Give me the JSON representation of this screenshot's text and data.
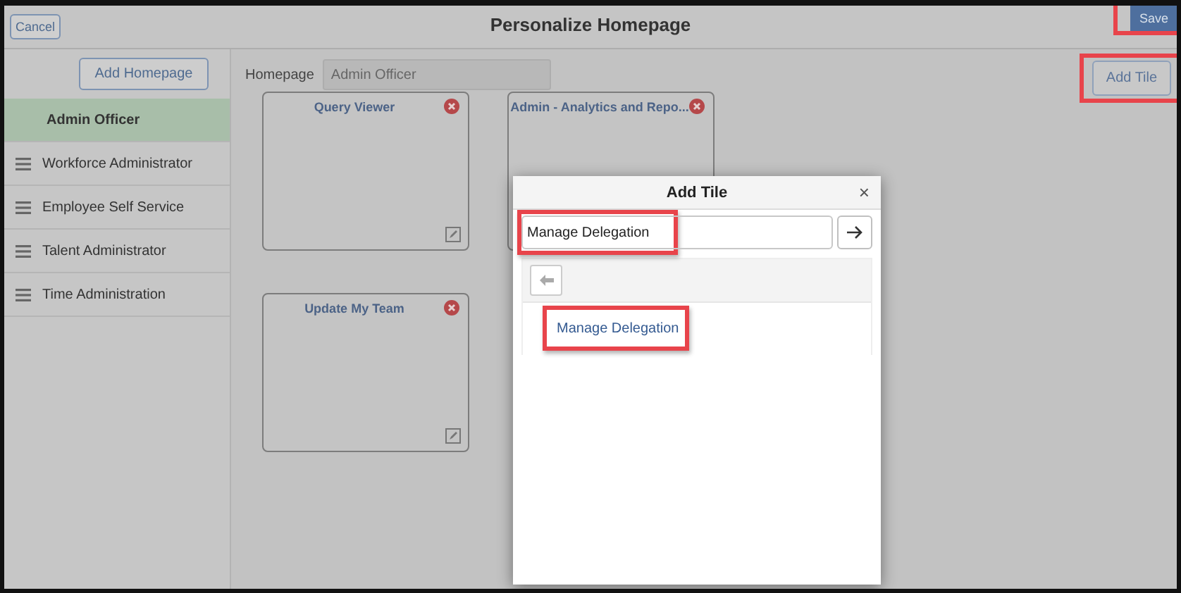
{
  "header": {
    "cancel": "Cancel",
    "title": "Personalize Homepage",
    "save": {
      "label": "Save",
      "highlighted": true
    }
  },
  "sidebar": {
    "add_button": "Add Homepage",
    "items": [
      {
        "label": "Admin Officer",
        "selected": true
      },
      {
        "label": "Workforce Administrator",
        "selected": false
      },
      {
        "label": "Employee Self Service",
        "selected": false
      },
      {
        "label": "Talent Administrator",
        "selected": false
      },
      {
        "label": "Time Administration",
        "selected": false
      }
    ]
  },
  "homepage_field": {
    "label": "Homepage",
    "value": "Admin Officer"
  },
  "add_tile": {
    "label": "Add Tile",
    "highlighted": true
  },
  "tiles": [
    {
      "title": "Query Viewer"
    },
    {
      "title": "Admin - Analytics and Repo..."
    },
    {
      "title": "Update My Team"
    }
  ],
  "dialog": {
    "title": "Add Tile",
    "close": "×",
    "search": {
      "value": "Manage Delegation",
      "highlighted": true
    },
    "results": [
      {
        "label": "Manage Delegation",
        "highlighted": true
      }
    ]
  }
}
